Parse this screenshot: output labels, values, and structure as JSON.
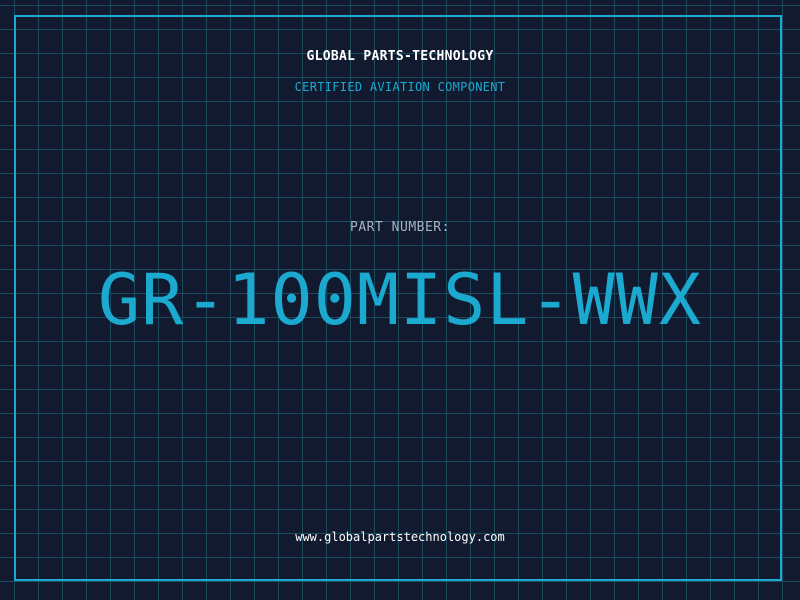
{
  "header": {
    "company_name": "GLOBAL PARTS-TECHNOLOGY",
    "tagline": "CERTIFIED AVIATION COMPONENT"
  },
  "part": {
    "label": "PART NUMBER:",
    "number": "GR-100MISL-WWX"
  },
  "footer": {
    "website": "www.globalpartstechnology.com"
  },
  "colors": {
    "background": "#111a2e",
    "grid": "#1c4a5e",
    "accent": "#1ba9cf",
    "label": "#a6b4c4",
    "text": "#ffffff"
  }
}
